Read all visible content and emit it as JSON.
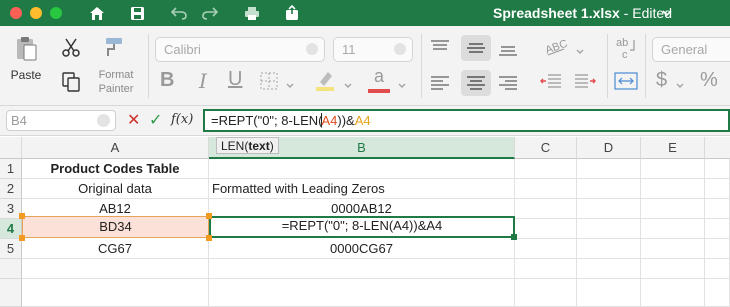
{
  "window": {
    "title": "Spreadsheet 1.xlsx",
    "status": " - Edited"
  },
  "ribbon": {
    "paste_label": "Paste",
    "format_painter_label": "Format Painter",
    "font_name": "Calibri",
    "font_size": "11",
    "number_format": "General",
    "font_color_bar": "#e24c4c",
    "highlight_color_bar": "#f4e27a"
  },
  "formula_bar": {
    "name_box": "B4",
    "fx_label": "f(x)",
    "formula_prefix": "=REPT(\"0\"; 8-LEN(",
    "formula_ref1": "A4",
    "formula_mid": "))&",
    "formula_ref2": "A4"
  },
  "tooltip": {
    "func": "LEN(",
    "arg": "text",
    "close": ")"
  },
  "grid": {
    "columns": [
      "A",
      "B",
      "C",
      "D",
      "E"
    ],
    "active_column": "B",
    "rows": [
      "1",
      "2",
      "3",
      "4",
      "5"
    ],
    "active_row": "4",
    "cells": {
      "A1": "Product Codes Table",
      "A2": "Original data",
      "B2": "Formatted with Leading Zeros",
      "A3": "AB12",
      "B3": "0000AB12",
      "A4": "BD34",
      "B4": "=REPT(\"0\"; 8-LEN(A4))&A4",
      "A5": "CG67",
      "B5": "0000CG67"
    }
  }
}
